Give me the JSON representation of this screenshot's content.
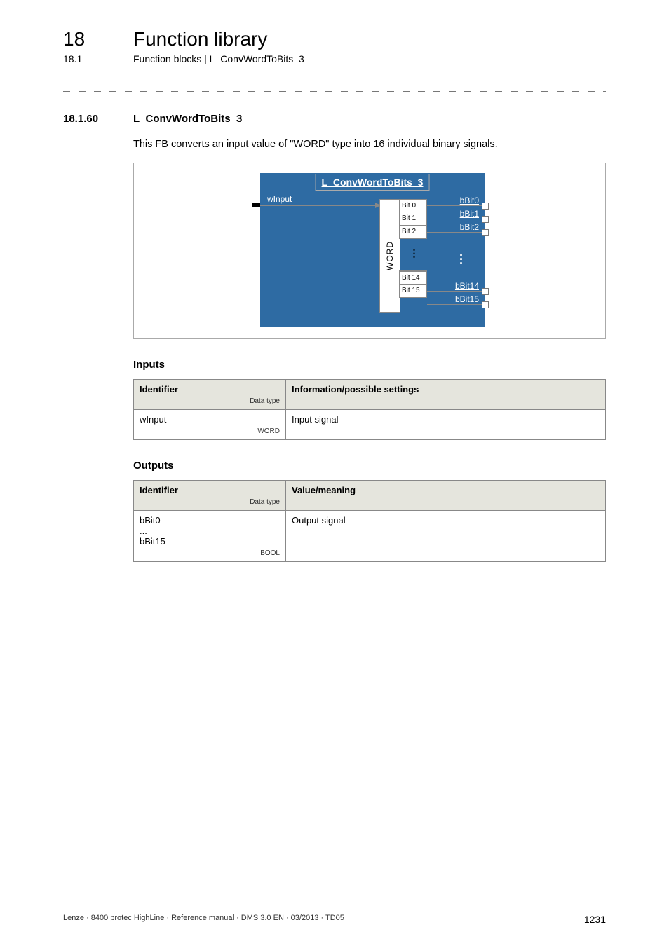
{
  "header": {
    "chapter_num": "18",
    "chapter_title": "Function library",
    "sub_num": "18.1",
    "sub_title": "Function blocks | L_ConvWordToBits_3"
  },
  "section": {
    "num": "18.1.60",
    "title": "L_ConvWordToBits_3",
    "intro": "This FB converts an input value of \"WORD\" type into 16 individual binary signals."
  },
  "diagram": {
    "block_title": "L_ConvWordToBits_3",
    "input_label": "wInput",
    "word_label": "WORD",
    "bits_top": [
      "Bit 0",
      "Bit 1",
      "Bit 2"
    ],
    "bits_bottom": [
      "Bit 14",
      "Bit 15"
    ],
    "outputs_top": [
      "bBit0",
      "bBit1",
      "bBit2"
    ],
    "outputs_bottom": [
      "bBit14",
      "bBit15"
    ]
  },
  "inputs_table": {
    "heading": "Inputs",
    "col_identifier": "Identifier",
    "col_datatype": "Data type",
    "col_info": "Information/possible settings",
    "rows": [
      {
        "id": "wInput",
        "dtype": "WORD",
        "info": "Input signal"
      }
    ]
  },
  "outputs_table": {
    "heading": "Outputs",
    "col_identifier": "Identifier",
    "col_datatype": "Data type",
    "col_info": "Value/meaning",
    "rows": [
      {
        "id": "bBit0\n...\nbBit15",
        "dtype": "BOOL",
        "info": "Output signal"
      }
    ]
  },
  "footer": {
    "left": "Lenze · 8400 protec HighLine · Reference manual · DMS 3.0 EN · 03/2013 · TD05",
    "right": "1231"
  }
}
